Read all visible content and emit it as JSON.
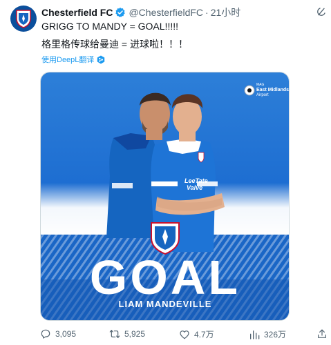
{
  "tweet": {
    "author_name": "Chesterfield FC",
    "handle": "@ChesterfieldFC",
    "separator": "·",
    "time": "21小时",
    "text_line1": "GRIGG TO MANDY = GOAL!!!!!",
    "text_line2": "格里格传球给曼迪 = 进球啦！！！",
    "translate_label": "使用DeepL翻译"
  },
  "media": {
    "sponsor_line1": "MAG",
    "sponsor_line2": "East Midlands",
    "sponsor_line3": "Airport",
    "shirt_sponsor_line1": "LeeTate",
    "shirt_sponsor_line2": "Valve",
    "headline": "GOAL",
    "player_name": "LIAM MANDEVILLE"
  },
  "actions": {
    "replies": "3,095",
    "retweets": "5,925",
    "likes": "4.7万",
    "views": "326万"
  },
  "colors": {
    "brand_blue": "#1565c0",
    "link_blue": "#1d9bf0",
    "muted": "#536471"
  },
  "icons": [
    "chesterfield-crest-icon",
    "verified-badge-icon",
    "grok-icon",
    "deepl-icon",
    "reply-icon",
    "retweet-icon",
    "like-icon",
    "views-icon",
    "share-icon"
  ]
}
